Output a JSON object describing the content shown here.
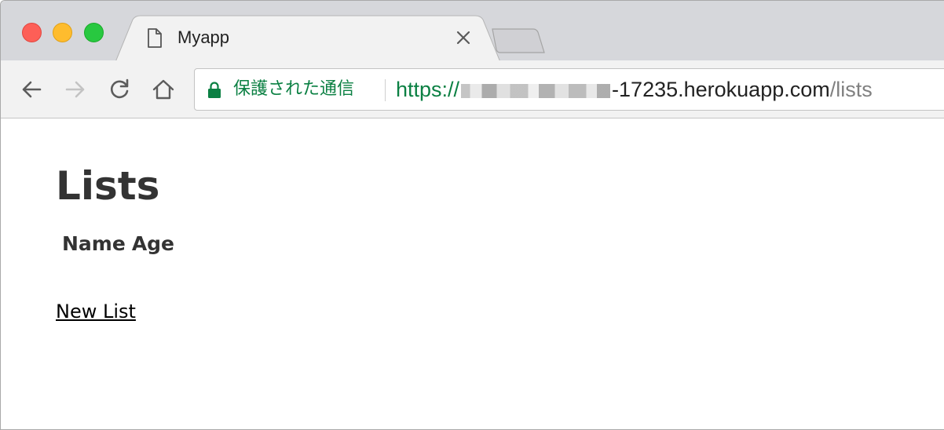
{
  "browser": {
    "tab": {
      "title": "Myapp",
      "icon": "document-icon"
    },
    "toolbar": {
      "back_icon": "arrow-left-icon",
      "forward_icon": "arrow-right-icon",
      "reload_icon": "reload-icon",
      "home_icon": "home-icon"
    },
    "omnibox": {
      "security_label": "保護された通信",
      "security_color": "#0b8043",
      "url_scheme": "https://",
      "url_host_visible": "-17235.herokuapp.com",
      "url_path": "/lists"
    }
  },
  "page": {
    "title": "Lists",
    "table": {
      "headers": [
        "Name",
        "Age"
      ]
    },
    "new_link": "New List"
  }
}
